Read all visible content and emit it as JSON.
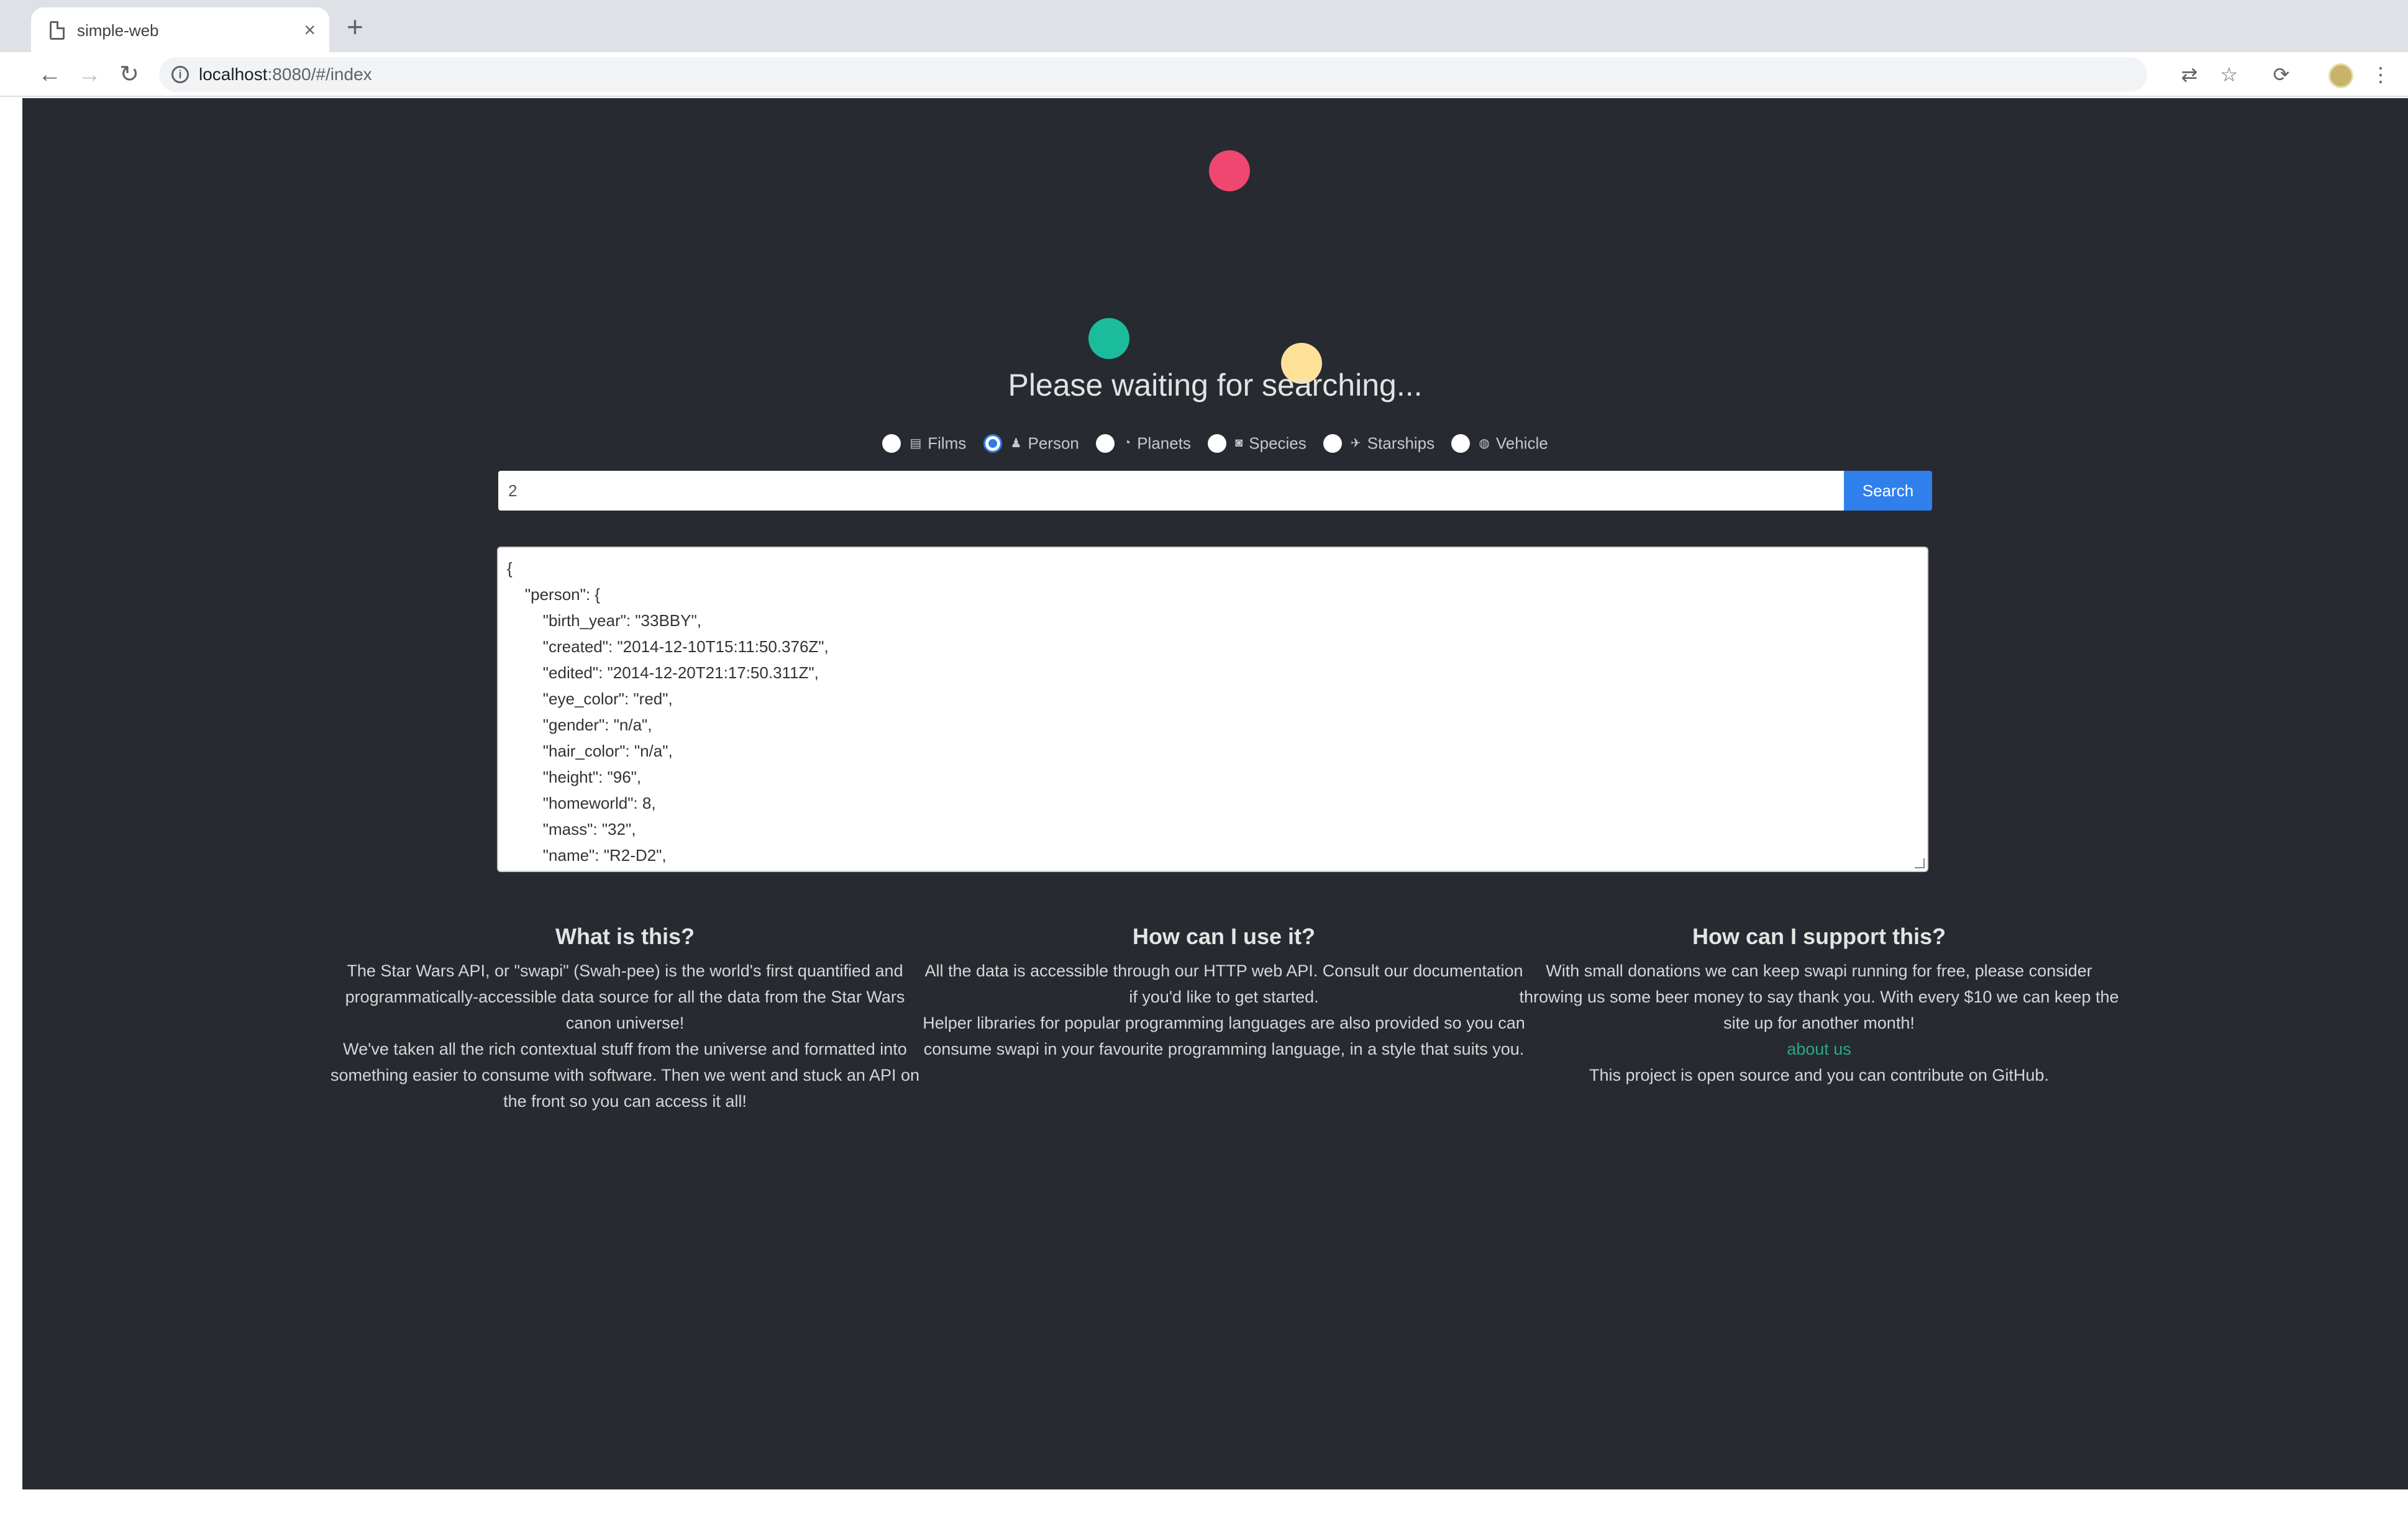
{
  "browser": {
    "tab_title": "simple-web",
    "tab_close": "×",
    "new_tab": "+",
    "url_host": "localhost",
    "url_path": ":8080/#/index"
  },
  "page": {
    "waiting_text": "Please waiting for searching...",
    "radios": [
      {
        "label": "Films",
        "icon": "film-icon",
        "glyph": "▤",
        "checked": false
      },
      {
        "label": "Person",
        "icon": "person-icon",
        "glyph": "♟",
        "checked": true
      },
      {
        "label": "Planets",
        "icon": "planet-icon",
        "glyph": "◔",
        "checked": false
      },
      {
        "label": "Species",
        "icon": "species-icon",
        "glyph": "◙",
        "checked": false
      },
      {
        "label": "Starships",
        "icon": "starship-icon",
        "glyph": "✈",
        "checked": false
      },
      {
        "label": "Vehicle",
        "icon": "vehicle-icon",
        "glyph": "◍",
        "checked": false
      }
    ],
    "search": {
      "value": "2",
      "button_label": "Search"
    },
    "result_lines": [
      "{",
      "    \"person\": {",
      "        \"birth_year\": \"33BBY\",",
      "        \"created\": \"2014-12-10T15:11:50.376Z\",",
      "        \"edited\": \"2014-12-20T21:17:50.311Z\",",
      "        \"eye_color\": \"red\",",
      "        \"gender\": \"n/a\",",
      "        \"hair_color\": \"n/a\",",
      "        \"height\": \"96\",",
      "        \"homeworld\": 8,",
      "        \"mass\": \"32\",",
      "        \"name\": \"R2-D2\","
    ],
    "info": {
      "what": {
        "title": "What is this?",
        "p1": "The Star Wars API, or \"swapi\" (Swah-pee) is the world's first quantified and programmatically-accessible data source for all the data from the Star Wars canon universe!",
        "p2": "We've taken all the rich contextual stuff from the universe and formatted into something easier to consume with software. Then we went and stuck an API on the front so you can access it all!"
      },
      "how": {
        "title": "How can I use it?",
        "p1": "All the data is accessible through our HTTP web API. Consult our documentation if you'd like to get started.",
        "p2": "Helper libraries for popular programming languages are also provided so you can consume swapi in your favourite programming language, in a style that suits you."
      },
      "support": {
        "title": "How can I support this?",
        "p1": "With small donations we can keep swapi running for free, please consider throwing us some beer money to say thank you. With every $10 we can keep the site up for another month!",
        "link": "about us",
        "p2": "This project is open source and you can contribute on GitHub."
      }
    }
  },
  "colors": {
    "page_bg": "#272a30",
    "dot_red": "#ef476f",
    "dot_teal": "#1abc9c",
    "dot_yellow": "#ffe29a",
    "search_button": "#2f80ed",
    "link": "#2aa884"
  }
}
